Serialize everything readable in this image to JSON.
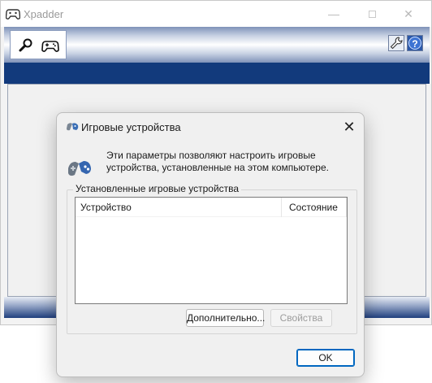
{
  "xpadder": {
    "title": "Xpadder",
    "controls": {
      "minimize": "—",
      "close": "✕"
    },
    "toolbar": {
      "search_icon": "magnifier-icon",
      "controller_icon": "gamepad-icon",
      "settings_icon": "wrench-icon",
      "help_icon": "help-icon"
    },
    "help_glyph": "?"
  },
  "dialog": {
    "title": "Игровые устройства",
    "close_glyph": "✕",
    "description": "Эти параметры позволяют настроить игровые устройства, установленные на этом компьютере.",
    "group_title": "Установленные игровые устройства",
    "columns": [
      "Устройство",
      "Состояние"
    ],
    "rows": [],
    "buttons": {
      "advanced": "Дополнительно...",
      "properties": "Свойства",
      "ok": "OK"
    }
  },
  "colors": {
    "accent": "#0067c0",
    "xpadder_band": "#123a7c"
  }
}
